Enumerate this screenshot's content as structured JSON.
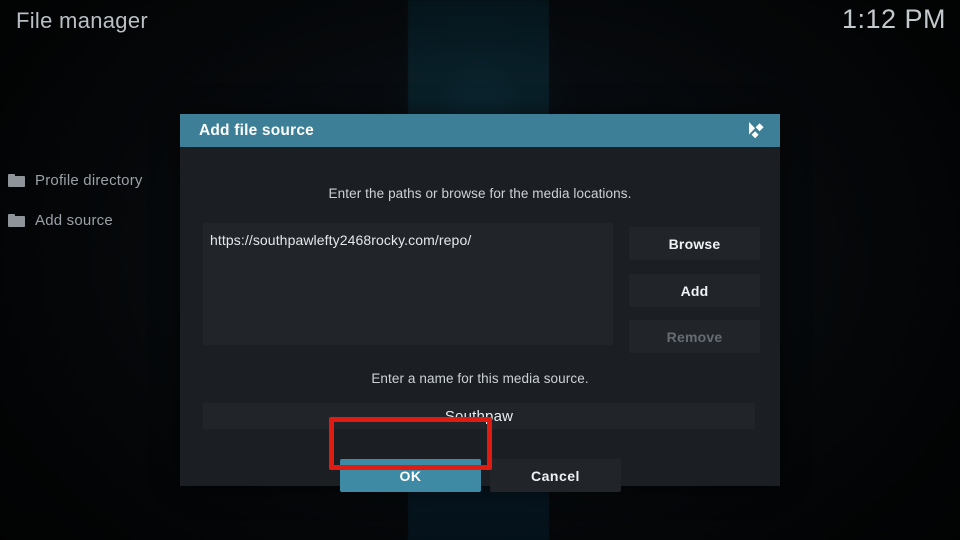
{
  "window": {
    "title": "File manager",
    "clock": "1:12 PM"
  },
  "sidebar": {
    "items": [
      {
        "icon": "folder-icon",
        "label": "Profile directory"
      },
      {
        "icon": "folder-icon",
        "label": "Add source"
      }
    ]
  },
  "dialog": {
    "title": "Add file source",
    "logo_icon": "kodi-logo-icon",
    "paths_hint": "Enter the paths or browse for the media locations.",
    "path_value": "https://southpawlefty2468rocky.com/repo/",
    "buttons": {
      "browse": "Browse",
      "add": "Add",
      "remove": "Remove",
      "ok": "OK",
      "cancel": "Cancel"
    },
    "name_hint": "Enter a name for this media source.",
    "name_value": "Southpaw"
  },
  "annotation": {
    "type": "rectangle-highlight",
    "target": "ok-button",
    "color": "#e01b12"
  },
  "colors": {
    "accent": "#3c7f97",
    "ok_button": "#3e8aa5",
    "dialog_bg": "#1b1f23",
    "field_bg": "#212529",
    "highlight": "#e01b12"
  }
}
